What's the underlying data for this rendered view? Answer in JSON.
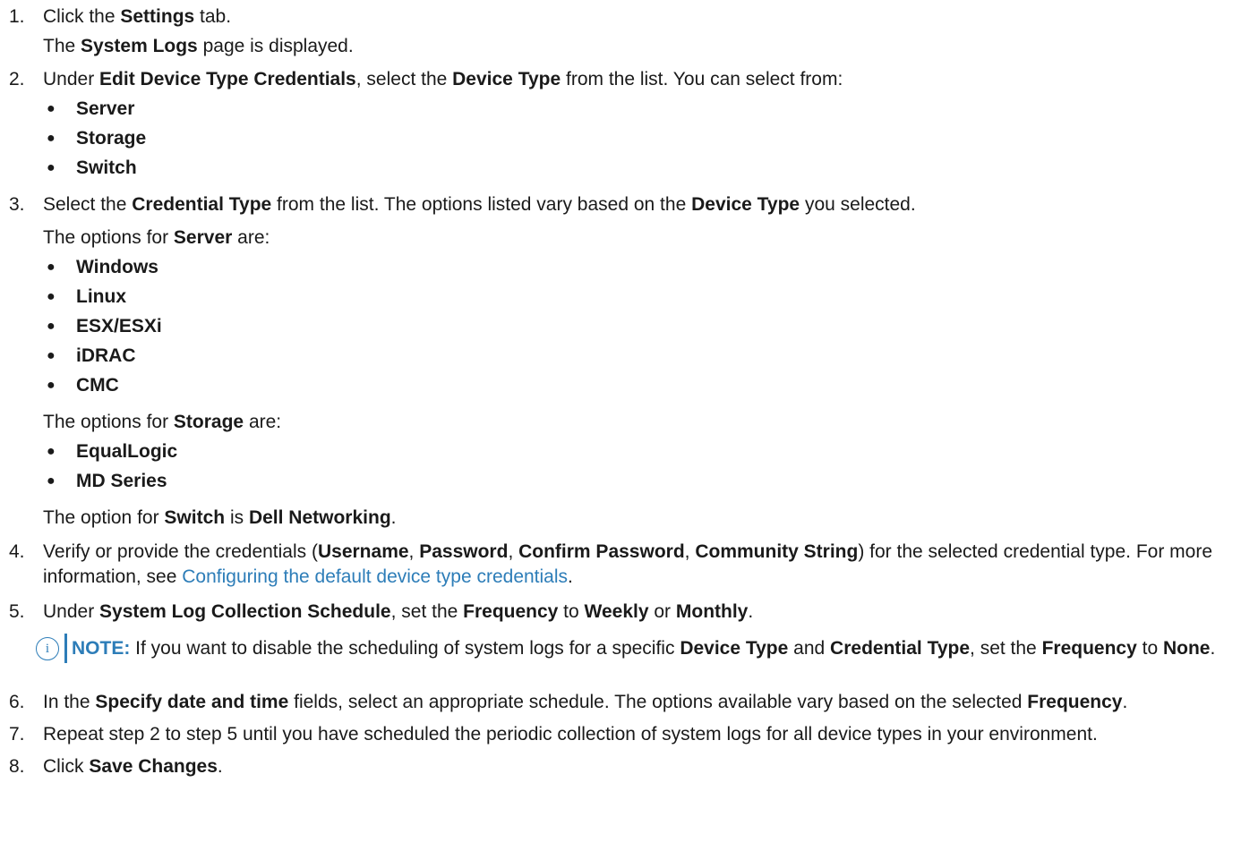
{
  "steps": [
    {
      "num": "1.",
      "parts": [
        "Click the ",
        "Settings",
        " tab."
      ],
      "sub": [
        "The ",
        "System Logs",
        " page is displayed."
      ]
    },
    {
      "num": "2.",
      "parts": [
        "Under ",
        "Edit Device Type Credentials",
        ", select the ",
        "Device Type",
        " from the list. You can select from:"
      ],
      "bullets": [
        "Server",
        "Storage",
        "Switch"
      ]
    },
    {
      "num": "3.",
      "parts": [
        "Select the ",
        "Credential Type",
        " from the list. The options listed vary based on the ",
        "Device Type",
        " you selected."
      ],
      "server_intro": [
        "The options for ",
        "Server",
        " are:"
      ],
      "server_bullets": [
        "Windows",
        "Linux",
        "ESX/ESXi",
        "iDRAC",
        "CMC"
      ],
      "storage_intro": [
        "The options for ",
        "Storage",
        " are:"
      ],
      "storage_bullets": [
        "EqualLogic",
        "MD Series"
      ],
      "switch_line": [
        "The option for ",
        "Switch",
        " is ",
        "Dell Networking",
        "."
      ]
    },
    {
      "num": "4.",
      "parts": [
        "Verify or provide the credentials (",
        "Username",
        ", ",
        "Password",
        ", ",
        "Confirm Password",
        ", ",
        "Community String",
        ") for the selected credential type. For more information, see ",
        "Configuring the default device type credentials",
        "."
      ]
    },
    {
      "num": "5.",
      "parts": [
        "Under ",
        "System Log Collection Schedule",
        ", set the ",
        "Frequency",
        " to ",
        "Weekly",
        " or ",
        "Monthly",
        "."
      ],
      "note": {
        "label": "NOTE:",
        "parts": [
          " If you want to disable the scheduling of system logs for a specific ",
          "Device Type",
          " and ",
          "Credential Type",
          ", set the ",
          "Frequency",
          " to ",
          "None",
          "."
        ]
      }
    },
    {
      "num": "6.",
      "parts": [
        "In the ",
        "Specify date and time",
        " fields, select an appropriate schedule. The options available vary based on the selected ",
        "Frequency",
        "."
      ]
    },
    {
      "num": "7.",
      "parts": [
        "Repeat step 2 to step 5 until you have scheduled the periodic collection of system logs for all device types in your environment."
      ]
    },
    {
      "num": "8.",
      "parts": [
        "Click ",
        "Save Changes",
        "."
      ]
    }
  ],
  "colors": {
    "accent": "#2d7db8",
    "text": "#1a1a1a"
  },
  "icons": {
    "note": "info-circle-icon"
  }
}
